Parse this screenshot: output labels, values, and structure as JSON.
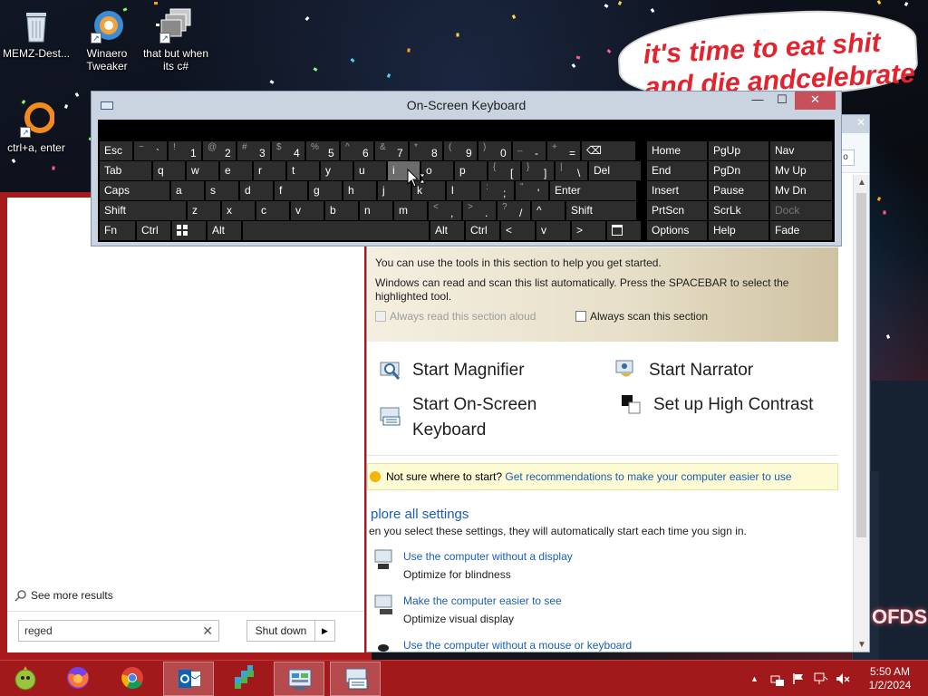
{
  "desktop": {
    "icons": [
      {
        "label": "MEMZ-Dest..."
      },
      {
        "label": "Winaero Tweaker"
      },
      {
        "label": "that but when its c#"
      },
      {
        "label": "ctrl+a, enter"
      }
    ],
    "meme_text_line1": "it's time to eat shit",
    "meme_text_line2": "and die andcelebrate",
    "sign_text": "OFDS"
  },
  "osk": {
    "title": "On-Screen Keyboard",
    "minimize_label": "—",
    "maximize_label": "☐",
    "close_label": "✕",
    "rows": [
      [
        {
          "label": "Esc"
        },
        {
          "sec": "~",
          "pri": "`"
        },
        {
          "sec": "!",
          "pri": "1"
        },
        {
          "sec": "@",
          "pri": "2"
        },
        {
          "sec": "#",
          "pri": "3"
        },
        {
          "sec": "$",
          "pri": "4"
        },
        {
          "sec": "%",
          "pri": "5"
        },
        {
          "sec": "^",
          "pri": "6"
        },
        {
          "sec": "&",
          "pri": "7"
        },
        {
          "sec": "*",
          "pri": "8"
        },
        {
          "sec": "(",
          "pri": "9"
        },
        {
          "sec": ")",
          "pri": "0"
        },
        {
          "sec": "_",
          "pri": "-"
        },
        {
          "sec": "+",
          "pri": "="
        },
        {
          "label": "⌫"
        }
      ],
      [
        {
          "label": "Tab"
        },
        {
          "label": "q"
        },
        {
          "label": "w"
        },
        {
          "label": "e"
        },
        {
          "label": "r"
        },
        {
          "label": "t"
        },
        {
          "label": "y"
        },
        {
          "label": "u"
        },
        {
          "label": "i"
        },
        {
          "label": "o"
        },
        {
          "label": "p"
        },
        {
          "sec": "{",
          "pri": "["
        },
        {
          "sec": "}",
          "pri": "]"
        },
        {
          "sec": "|",
          "pri": "\\"
        },
        {
          "label": "Del"
        }
      ],
      [
        {
          "label": "Caps"
        },
        {
          "label": "a"
        },
        {
          "label": "s"
        },
        {
          "label": "d"
        },
        {
          "label": "f"
        },
        {
          "label": "g"
        },
        {
          "label": "h"
        },
        {
          "label": "j"
        },
        {
          "label": "k"
        },
        {
          "label": "l"
        },
        {
          "sec": ":",
          "pri": ";"
        },
        {
          "sec": "\"",
          "pri": "'"
        },
        {
          "label": "Enter"
        }
      ],
      [
        {
          "label": "Shift"
        },
        {
          "label": "z"
        },
        {
          "label": "x"
        },
        {
          "label": "c"
        },
        {
          "label": "v"
        },
        {
          "label": "b"
        },
        {
          "label": "n"
        },
        {
          "label": "m"
        },
        {
          "sec": "<",
          "pri": ","
        },
        {
          "sec": ">",
          "pri": "."
        },
        {
          "sec": "?",
          "pri": "/"
        },
        {
          "label": "^"
        },
        {
          "label": "Shift"
        }
      ],
      [
        {
          "label": "Fn"
        },
        {
          "label": "Ctrl"
        },
        {
          "label": "win"
        },
        {
          "label": "Alt"
        },
        {
          "label": ""
        },
        {
          "label": "Alt"
        },
        {
          "label": "Ctrl"
        },
        {
          "label": "<"
        },
        {
          "label": "v"
        },
        {
          "label": ">"
        },
        {
          "label": "menu"
        }
      ]
    ],
    "nav_rows": [
      [
        "Home",
        "PgUp",
        "Nav"
      ],
      [
        "End",
        "PgDn",
        "Mv Up"
      ],
      [
        "Insert",
        "Pause",
        "Mv Dn"
      ],
      [
        "PrtScn",
        "ScrLk",
        "Dock"
      ],
      [
        "Options",
        "Help",
        "Fade"
      ]
    ],
    "pressed_key": "i"
  },
  "ease": {
    "intro": "You can use the tools in this section to help you get started.",
    "scan_info_line1": "Windows can read and scan this list automatically.  Press the SPACEBAR to select the",
    "scan_info_line2": "highlighted tool.",
    "always_read_label": "Always read this section aloud",
    "always_scan_label": "Always scan this section",
    "tools": {
      "magnifier": "Start Magnifier",
      "narrator": "Start Narrator",
      "osk_line1": "Start On-Screen",
      "osk_line2": "Keyboard",
      "high_contrast": "Set up High Contrast"
    },
    "recommend_prefix": "Not sure where to start?",
    "recommend_link": "Get recommendations to make your computer easier to use",
    "explore_title": "plore all settings",
    "explore_desc": "en you select these settings, they will automatically start each time you sign in.",
    "settings": [
      {
        "link": "Use the computer without a display",
        "desc": "Optimize for blindness"
      },
      {
        "link": "Make the computer easier to see",
        "desc": "Optimize visual display"
      },
      {
        "link": "Use the computer without a mouse or keyboard",
        "desc": ""
      }
    ]
  },
  "search": {
    "see_more": "See more results",
    "query": "reged",
    "clear_label": "✕",
    "shutdown_label": "Shut down",
    "shutdown_arrow": "▶"
  },
  "taskbar": {
    "clock_time": "5:50 AM",
    "clock_date": "1/2/2024",
    "tray_up_arrow": "▲",
    "items": [
      "ie-mascot",
      "firefox",
      "chrome",
      "outlook",
      "regedit",
      "control-panel",
      "on-screen-keyboard"
    ],
    "active_items": [
      "outlook",
      "control-panel",
      "on-screen-keyboard"
    ]
  },
  "colors": {
    "taskbar": "#a1191b",
    "key": "#2d2d2d",
    "link": "#1a5fb4",
    "meme_text": "#e3232d"
  }
}
